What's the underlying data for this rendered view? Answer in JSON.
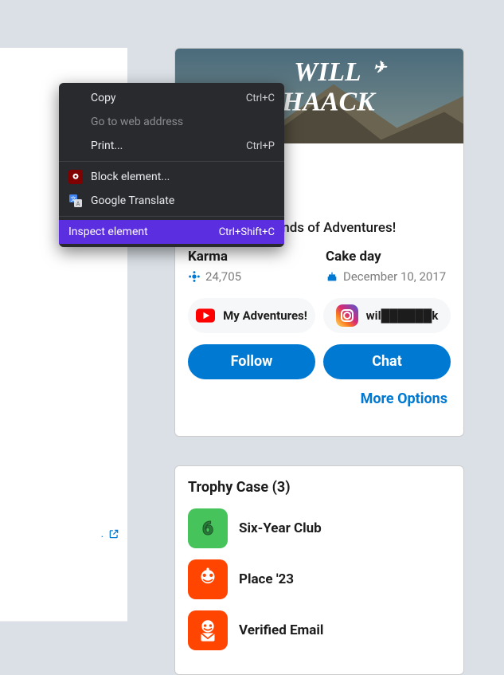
{
  "left": {
    "external_link_label": "."
  },
  "context_menu": {
    "copy": {
      "label": "Copy",
      "shortcut": "Ctrl+C"
    },
    "goto": {
      "label": "Go to web address"
    },
    "print": {
      "label": "Print...",
      "shortcut": "Ctrl+P"
    },
    "block": {
      "label": "Block element..."
    },
    "gtrans": {
      "label": "Google Translate"
    },
    "inspect": {
      "label": "Inspect element",
      "shortcut": "Ctrl+Shift+C"
    }
  },
  "profile": {
    "banner_text_top": "WILL",
    "banner_text_bottom": "HAACK",
    "tagline": "outube for all kinds of Adventures!",
    "karma_label": "Karma",
    "karma_value": "24,705",
    "cakeday_label": "Cake day",
    "cakeday_value": "December 10, 2017",
    "link1": "My Adventures!",
    "link2": "wil██████k",
    "follow": "Follow",
    "chat": "Chat",
    "more": "More Options"
  },
  "trophies": {
    "title": "Trophy Case (3)",
    "items": [
      {
        "name": "Six-Year Club",
        "icon": "six-year"
      },
      {
        "name": "Place '23",
        "icon": "place23"
      },
      {
        "name": "Verified Email",
        "icon": "verified-email"
      }
    ]
  }
}
